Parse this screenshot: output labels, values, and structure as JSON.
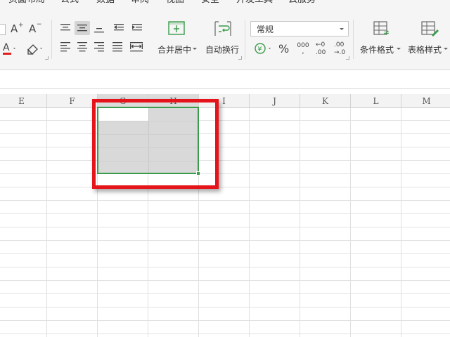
{
  "menu": {
    "tabs": [
      "页面布局",
      "公式",
      "数据",
      "审阅",
      "视图",
      "安全",
      "开发工具",
      "云服务"
    ]
  },
  "ribbon": {
    "merge_center": "合并居中",
    "wrap_text": "自动换行",
    "number_format": "常规",
    "percent": "%",
    "thousands": "000",
    "inc_decimal": "←0\n.00",
    "dec_decimal": ".00\n→.0",
    "cond_format": "条件格式",
    "table_style": "表格样式"
  },
  "columns": [
    "E",
    "F",
    "G",
    "H",
    "I",
    "J",
    "K",
    "L",
    "M"
  ],
  "selected_columns": [
    "G",
    "H"
  ],
  "colors": {
    "selection_border": "#3a9c4a",
    "highlight": "#e5141b",
    "font_color": "#e0201e"
  }
}
